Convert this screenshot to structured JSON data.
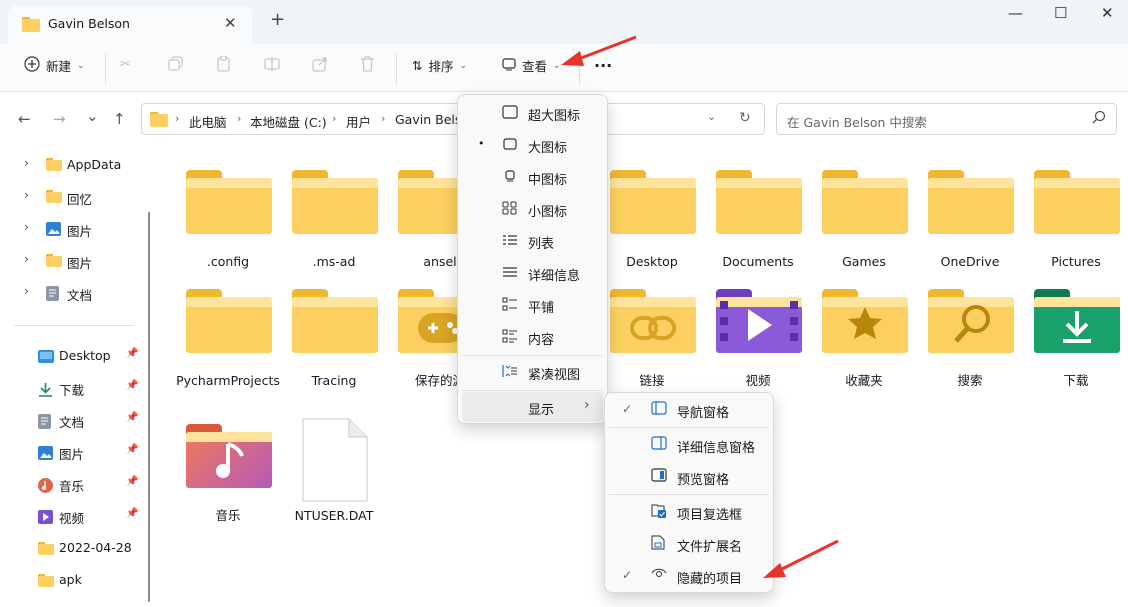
{
  "window": {
    "tab_title": "Gavin Belson",
    "new_tab": "+",
    "minimize": "—",
    "maximize": "☐",
    "close": "✕"
  },
  "toolbar": {
    "new_label": "新建",
    "sort_label": "排序",
    "view_label": "查看",
    "more_label": "···"
  },
  "nav": {
    "back": "←",
    "forward": "→",
    "recent": "⌄",
    "up": "↑",
    "breadcrumbs": [
      "此电脑",
      "本地磁盘 (C:)",
      "用户",
      "Gavin Belso"
    ],
    "refresh": "↻",
    "search_placeholder": "在 Gavin Belson 中搜索"
  },
  "sidebar": {
    "tree": [
      {
        "label": "AppData",
        "icon": "folder-icon"
      },
      {
        "label": "回忆",
        "icon": "folder-icon"
      },
      {
        "label": "图片",
        "icon": "pictures-icon"
      },
      {
        "label": "图片",
        "icon": "folder-icon"
      },
      {
        "label": "文档",
        "icon": "document-icon"
      }
    ],
    "quick_access": [
      {
        "label": "Desktop",
        "icon": "desktop-icon",
        "pinned": true
      },
      {
        "label": "下载",
        "icon": "download-icon",
        "pinned": true
      },
      {
        "label": "文档",
        "icon": "document-icon",
        "pinned": true
      },
      {
        "label": "图片",
        "icon": "pictures-icon",
        "pinned": true
      },
      {
        "label": "音乐",
        "icon": "music-icon",
        "pinned": true
      },
      {
        "label": "视频",
        "icon": "video-icon",
        "pinned": true
      },
      {
        "label": "2022-04-28",
        "icon": "folder-icon",
        "pinned": false
      },
      {
        "label": "apk",
        "icon": "folder-icon",
        "pinned": false
      }
    ]
  },
  "files": [
    {
      "name": ".config"
    },
    {
      "name": ".ms-ad"
    },
    {
      "name": "ansel"
    },
    {
      "name": "Desktop"
    },
    {
      "name": "Documents"
    },
    {
      "name": "Games"
    },
    {
      "name": "OneDrive"
    },
    {
      "name": "Pictures"
    },
    {
      "name": "PycharmProjects"
    },
    {
      "name": "Tracing"
    },
    {
      "name": "保存的游"
    },
    {
      "name": "链接"
    },
    {
      "name": "视频"
    },
    {
      "name": "收藏夹"
    },
    {
      "name": "搜索"
    },
    {
      "name": "下载"
    },
    {
      "name": "音乐"
    },
    {
      "name": "NTUSER.DAT"
    }
  ],
  "view_menu": {
    "items": [
      {
        "label": "超大图标",
        "icon": "extra-large-icons-icon",
        "selected": false
      },
      {
        "label": "大图标",
        "icon": "large-icons-icon",
        "selected": true
      },
      {
        "label": "中图标",
        "icon": "medium-icons-icon",
        "selected": false
      },
      {
        "label": "小图标",
        "icon": "small-icons-icon",
        "selected": false
      },
      {
        "label": "列表",
        "icon": "list-icon",
        "selected": false
      },
      {
        "label": "详细信息",
        "icon": "details-icon",
        "selected": false
      },
      {
        "label": "平铺",
        "icon": "tiles-icon",
        "selected": false
      },
      {
        "label": "内容",
        "icon": "content-icon",
        "selected": false
      },
      {
        "label": "紧凑视图",
        "icon": "compact-view-icon",
        "selected": false
      },
      {
        "label": "显示",
        "icon": "",
        "selected": false
      }
    ],
    "selected_marker": "•",
    "submenu_arrow": "›"
  },
  "show_submenu": {
    "items": [
      {
        "label": "导航窗格",
        "icon": "navigation-pane-icon",
        "checked": true
      },
      {
        "label": "详细信息窗格",
        "icon": "details-pane-icon",
        "checked": false
      },
      {
        "label": "预览窗格",
        "icon": "preview-pane-icon",
        "checked": false
      },
      {
        "label": "项目复选框",
        "icon": "item-checkbox-icon",
        "checked": false
      },
      {
        "label": "文件扩展名",
        "icon": "file-extension-icon",
        "checked": false
      },
      {
        "label": "隐藏的项目",
        "icon": "hidden-items-icon",
        "checked": true
      }
    ],
    "check_mark": "✓"
  },
  "colors": {
    "folder_yellow": "#fbd061",
    "folder_tab": "#f2b731",
    "annotation_red": "#e8332a",
    "accent_blue": "#0067c0"
  }
}
